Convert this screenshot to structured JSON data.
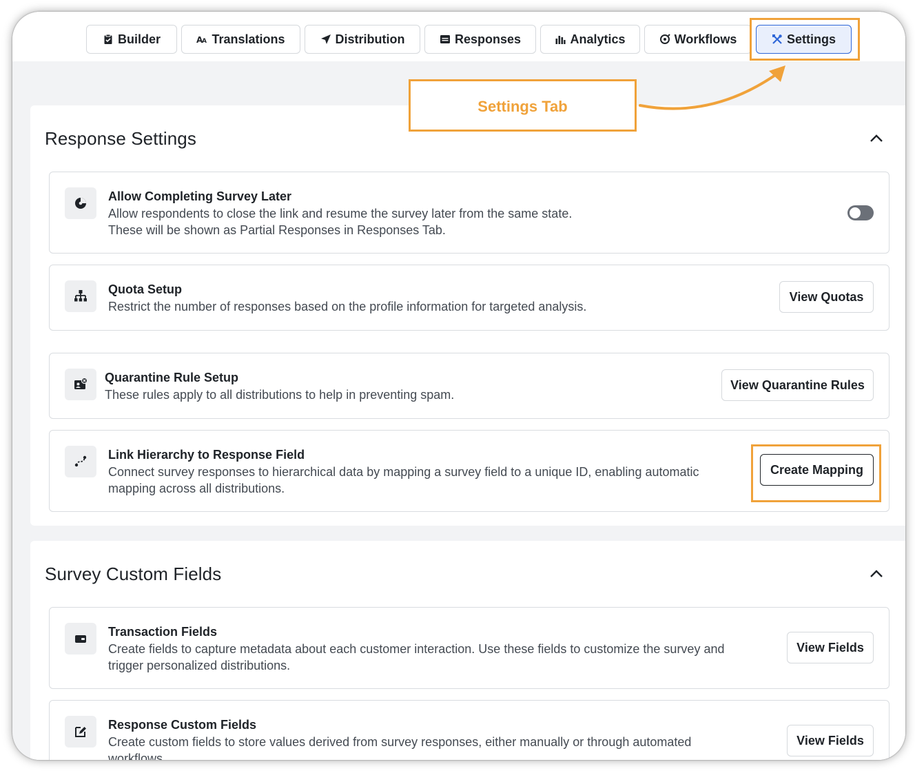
{
  "tabs": [
    {
      "label": "Builder",
      "icon": "clipboard-icon"
    },
    {
      "label": "Translations",
      "icon": "translate-icon"
    },
    {
      "label": "Distribution",
      "icon": "send-icon"
    },
    {
      "label": "Responses",
      "icon": "list-icon"
    },
    {
      "label": "Analytics",
      "icon": "bar-chart-icon"
    },
    {
      "label": "Workflows",
      "icon": "workflow-icon"
    },
    {
      "label": "Settings",
      "icon": "tools-icon",
      "active": true
    }
  ],
  "callout": {
    "label": "Settings Tab"
  },
  "response_settings": {
    "title": "Response Settings",
    "cards": [
      {
        "title": "Allow Completing Survey Later",
        "desc": "Allow respondents to close the link and resume the survey later from the same state.",
        "desc2": "These will be shown as Partial Responses in Responses Tab.",
        "toggle_on": false
      },
      {
        "title": "Quota Setup",
        "desc": "Restrict the number of responses based on the profile information for targeted analysis.",
        "button": "View Quotas"
      },
      {
        "title": "Quarantine Rule Setup",
        "desc": "These rules apply to all distributions to help in preventing spam.",
        "button": "View Quarantine Rules"
      },
      {
        "title": "Link Hierarchy to Response Field",
        "desc": "Connect survey responses to hierarchical data by mapping a survey field to a unique ID, enabling automatic",
        "desc2": "mapping across all distributions.",
        "button": "Create Mapping"
      }
    ]
  },
  "custom_fields": {
    "title": "Survey Custom Fields",
    "cards": [
      {
        "title": "Transaction Fields",
        "desc": "Create fields to capture metadata about each customer interaction. Use these fields to customize the survey and",
        "desc2": "trigger personalized distributions.",
        "button": "View Fields"
      },
      {
        "title": "Response Custom Fields",
        "desc": "Create custom fields to store values derived from survey responses, either manually or through automated",
        "desc2": "workflows.",
        "button": "View Fields"
      }
    ]
  },
  "colors": {
    "highlight": "#f0a23a",
    "active_tab_border": "#2f67d8",
    "active_tab_bg": "#e9effc"
  }
}
